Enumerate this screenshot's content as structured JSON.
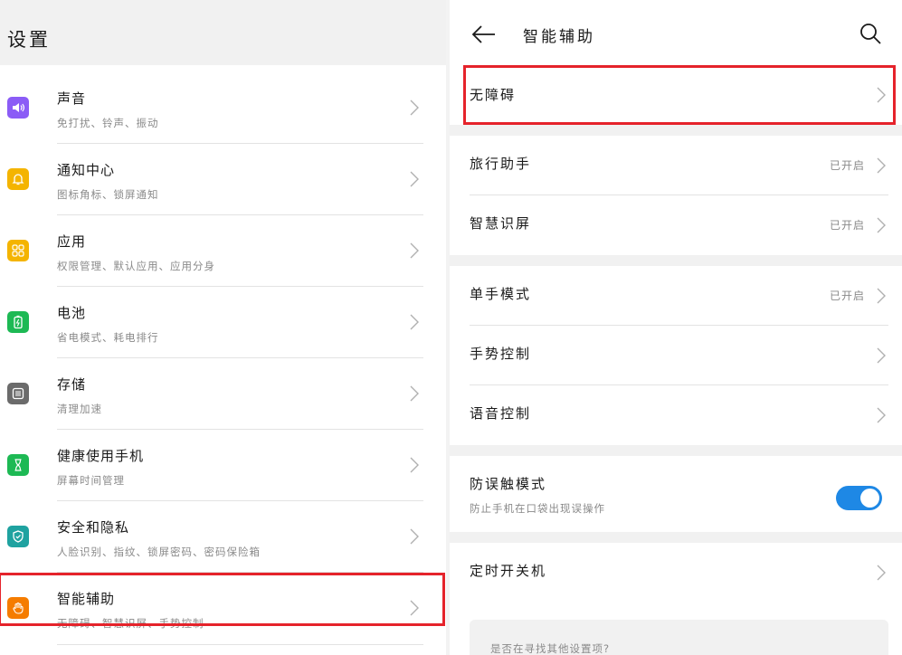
{
  "settings": {
    "title": "设置",
    "items": [
      {
        "title": "声音",
        "subtitle": "免打扰、铃声、振动",
        "icon": "sound-icon",
        "color": "#8b5cf6"
      },
      {
        "title": "通知中心",
        "subtitle": "图标角标、锁屏通知",
        "icon": "bell-icon",
        "color": "#f4b400"
      },
      {
        "title": "应用",
        "subtitle": "权限管理、默认应用、应用分身",
        "icon": "apps-grid-icon",
        "color": "#f4b400"
      },
      {
        "title": "电池",
        "subtitle": "省电模式、耗电排行",
        "icon": "battery-icon",
        "color": "#1db954"
      },
      {
        "title": "存储",
        "subtitle": "清理加速",
        "icon": "storage-icon",
        "color": "#6b6b6b"
      },
      {
        "title": "健康使用手机",
        "subtitle": "屏幕时间管理",
        "icon": "hourglass-icon",
        "color": "#1db954"
      },
      {
        "title": "安全和隐私",
        "subtitle": "人脸识别、指纹、锁屏密码、密码保险箱",
        "icon": "shield-icon",
        "color": "#1fa2a0"
      },
      {
        "title": "智能辅助",
        "subtitle": "无障碍、智慧识屏、手势控制",
        "icon": "hand-icon",
        "color": "#f57c00"
      }
    ]
  },
  "assist": {
    "title": "智能辅助",
    "back_icon": "back-arrow-icon",
    "search_icon": "search-icon",
    "items": [
      {
        "label": "无障碍",
        "status": ""
      },
      {
        "label": "旅行助手",
        "status": "已开启"
      },
      {
        "label": "智慧识屏",
        "status": "已开启"
      },
      {
        "label": "单手模式",
        "status": "已开启"
      },
      {
        "label": "手势控制",
        "status": ""
      },
      {
        "label": "语音控制",
        "status": ""
      },
      {
        "label": "防误触模式",
        "subtitle": "防止手机在口袋出现误操作",
        "toggle_on": true
      },
      {
        "label": "定时开关机",
        "status": ""
      }
    ],
    "hint": "是否在寻找其他设置项?"
  },
  "colors": {
    "accent": "#1e88e5",
    "highlight": "#e5232b"
  }
}
